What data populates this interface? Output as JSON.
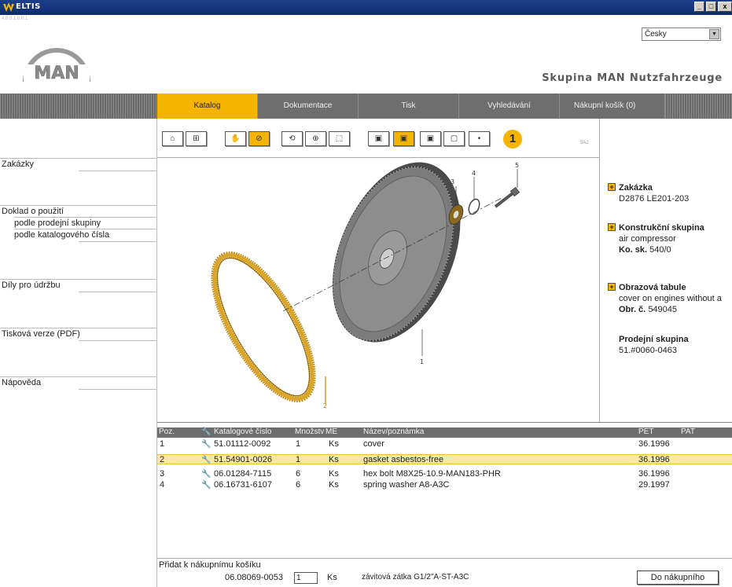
{
  "window": {
    "title": "ELTIS",
    "min": "_",
    "max": "□",
    "close": "x"
  },
  "header": {
    "version_text": "4.0.0.1.0.0.1",
    "logo_text": "MAN",
    "language": "Česky",
    "group_title": "Skupina MAN Nutzfahrzeuge"
  },
  "nav": {
    "tabs": [
      {
        "label": "Katalog"
      },
      {
        "label": "Dokumentace"
      },
      {
        "label": "Tisk"
      },
      {
        "label": "Vyhledávání"
      },
      {
        "label": "Nákupní košík (0)"
      }
    ]
  },
  "sidebar": {
    "orders": "Zakázky",
    "usage": "Doklad o použití",
    "by_group": "podle prodejní skupiny",
    "by_catalog": "podle katalogového čísla",
    "maintenance": "Díly pro údržbu",
    "pdf": "Tisková verze (PDF)",
    "help": "Nápověda"
  },
  "toolbar": {
    "step_badge": "1",
    "code": "5A2",
    "selected_index": "1"
  },
  "drawing": {
    "callouts": [
      "1",
      "2",
      "3",
      "4",
      "5"
    ]
  },
  "info": {
    "order_label": "Zakázka",
    "order_value": "D2876 LE201-203",
    "construction_label": "Konstrukční skupina",
    "construction_value": "air compressor",
    "ko_label": "Ko. sk.",
    "ko_value": "540/0",
    "figure_label": "Obrazová tabule",
    "figure_value": "cover on engines without a",
    "fig_no_label": "Obr. č.",
    "fig_no_value": "549045",
    "sales_label": "Prodejní skupina",
    "sales_value": "51.#0060-0463"
  },
  "parts": {
    "headers": {
      "pos": "Poz.",
      "catalog": "Katalogové číslo",
      "qty": "Množství",
      "unit": "ME",
      "name": "Název/poznámka",
      "pet": "PET",
      "pat": "PAT"
    },
    "rows": [
      {
        "pos": "1",
        "catalog": "51.01112-0092",
        "qty": "1",
        "unit": "Ks",
        "name": "cover",
        "pet": "36.1996",
        "pat": ""
      },
      {
        "pos": "2",
        "catalog": "51.54901-0026",
        "qty": "1",
        "unit": "Ks",
        "name": "gasket asbestos-free",
        "pet": "36.1996",
        "pat": ""
      },
      {
        "pos": "3",
        "catalog": "06.01284-7115",
        "qty": "6",
        "unit": "Ks",
        "name": "hex bolt M8X25-10.9-MAN183-PHR",
        "pet": "36.1996",
        "pat": ""
      },
      {
        "pos": "4",
        "catalog": "06.16731-6107",
        "qty": "6",
        "unit": "Ks",
        "name": "spring washer A8-A3C",
        "pet": "29.1997",
        "pat": ""
      }
    ],
    "selected_row": 2
  },
  "bottom": {
    "add_label": "Přidat k nákupnímu košíku",
    "part_number": "06.08069-0053",
    "quantity": "1",
    "unit": "Ks",
    "description": "závitová zátka G1/2\"A-ST-A3C",
    "add_button": "Do nákupního"
  },
  "colors": {
    "accent": "#f5b400",
    "nav_bg": "#6e6e6e",
    "title_bar": "#0e2a6e",
    "selected_row": "#fce6a8"
  }
}
